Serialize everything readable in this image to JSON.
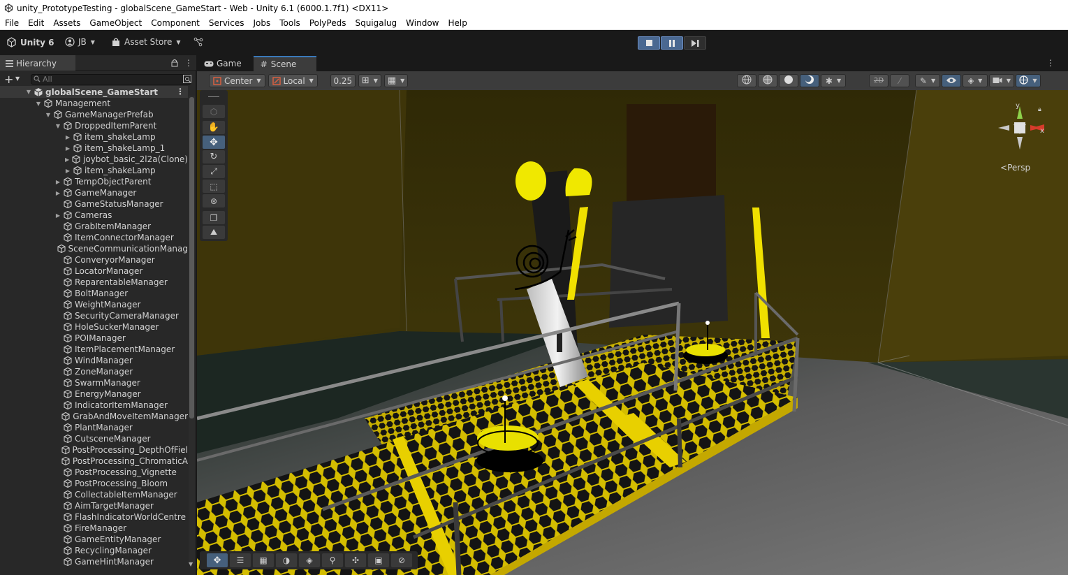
{
  "window": {
    "title": "unity_PrototypeTesting - globalScene_GameStart - Web - Unity 6.1 (6000.1.7f1) <DX11>"
  },
  "menu": [
    "File",
    "Edit",
    "Assets",
    "GameObject",
    "Component",
    "Services",
    "Jobs",
    "Tools",
    "PolyPeds",
    "Squigalug",
    "Window",
    "Help"
  ],
  "toolbar": {
    "unity_label": "Unity 6",
    "account_label": "JB",
    "asset_store_label": "Asset Store"
  },
  "hierarchy": {
    "tab_label": "Hierarchy",
    "search_placeholder": "All",
    "scene_name": "globalScene_GameStart",
    "items": [
      {
        "label": "Management",
        "depth": 1,
        "arrow": "open"
      },
      {
        "label": "GameManagerPrefab",
        "depth": 2,
        "arrow": "open"
      },
      {
        "label": "DroppedItemParent",
        "depth": 3,
        "arrow": "open"
      },
      {
        "label": "item_shakeLamp",
        "depth": 4,
        "arrow": "closed"
      },
      {
        "label": "item_shakeLamp_1",
        "depth": 4,
        "arrow": "closed"
      },
      {
        "label": "joybot_basic_2l2a(Clone)",
        "depth": 4,
        "arrow": "closed"
      },
      {
        "label": "item_shakeLamp",
        "depth": 4,
        "arrow": "closed"
      },
      {
        "label": "TempObjectParent",
        "depth": 3,
        "arrow": "closed"
      },
      {
        "label": "GameManager",
        "depth": 3,
        "arrow": "closed"
      },
      {
        "label": "GameStatusManager",
        "depth": 3,
        "arrow": "none"
      },
      {
        "label": "Cameras",
        "depth": 3,
        "arrow": "closed"
      },
      {
        "label": "GrabItemManager",
        "depth": 3,
        "arrow": "none"
      },
      {
        "label": "ItemConnectorManager",
        "depth": 3,
        "arrow": "none"
      },
      {
        "label": "SceneCommunicationManag",
        "depth": 3,
        "arrow": "none"
      },
      {
        "label": "ConveryorManager",
        "depth": 3,
        "arrow": "none"
      },
      {
        "label": "LocatorManager",
        "depth": 3,
        "arrow": "none"
      },
      {
        "label": "ReparentableManager",
        "depth": 3,
        "arrow": "none"
      },
      {
        "label": "BoltManager",
        "depth": 3,
        "arrow": "none"
      },
      {
        "label": "WeightManager",
        "depth": 3,
        "arrow": "none"
      },
      {
        "label": "SecurityCameraManager",
        "depth": 3,
        "arrow": "none"
      },
      {
        "label": "HoleSuckerManager",
        "depth": 3,
        "arrow": "none"
      },
      {
        "label": "POIManager",
        "depth": 3,
        "arrow": "none"
      },
      {
        "label": "ItemPlacementManager",
        "depth": 3,
        "arrow": "none"
      },
      {
        "label": "WindManager",
        "depth": 3,
        "arrow": "none"
      },
      {
        "label": "ZoneManager",
        "depth": 3,
        "arrow": "none"
      },
      {
        "label": "SwarmManager",
        "depth": 3,
        "arrow": "none"
      },
      {
        "label": "EnergyManager",
        "depth": 3,
        "arrow": "none"
      },
      {
        "label": "IndicatorItemManager",
        "depth": 3,
        "arrow": "none"
      },
      {
        "label": "GrabAndMoveItemManager",
        "depth": 3,
        "arrow": "none"
      },
      {
        "label": "PlantManager",
        "depth": 3,
        "arrow": "none"
      },
      {
        "label": "CutsceneManager",
        "depth": 3,
        "arrow": "none"
      },
      {
        "label": "PostProcessing_DepthOfFiel",
        "depth": 3,
        "arrow": "none"
      },
      {
        "label": "PostProcessing_ChromaticA",
        "depth": 3,
        "arrow": "none"
      },
      {
        "label": "PostProcessing_Vignette",
        "depth": 3,
        "arrow": "none"
      },
      {
        "label": "PostProcessing_Bloom",
        "depth": 3,
        "arrow": "none"
      },
      {
        "label": "CollectableItemManager",
        "depth": 3,
        "arrow": "none"
      },
      {
        "label": "AimTargetManager",
        "depth": 3,
        "arrow": "none"
      },
      {
        "label": "FlashIndicatorWorldCentre",
        "depth": 3,
        "arrow": "none"
      },
      {
        "label": "FireManager",
        "depth": 3,
        "arrow": "none"
      },
      {
        "label": "GameEntityManager",
        "depth": 3,
        "arrow": "none"
      },
      {
        "label": "RecyclingManager",
        "depth": 3,
        "arrow": "none"
      },
      {
        "label": "GameHintManager",
        "depth": 3,
        "arrow": "none"
      }
    ]
  },
  "scene": {
    "tabs": [
      {
        "label": "Game",
        "active": false
      },
      {
        "label": "Scene",
        "active": true
      }
    ],
    "pivot_label": "Center",
    "space_label": "Local",
    "snap_value": "0.25",
    "persp_label": "Persp",
    "gizmo_axes": {
      "y": "y",
      "x": "x"
    }
  },
  "colors": {
    "accent": "#3a79bb",
    "yellow": "#e8d000",
    "wall": "#3d3408"
  }
}
